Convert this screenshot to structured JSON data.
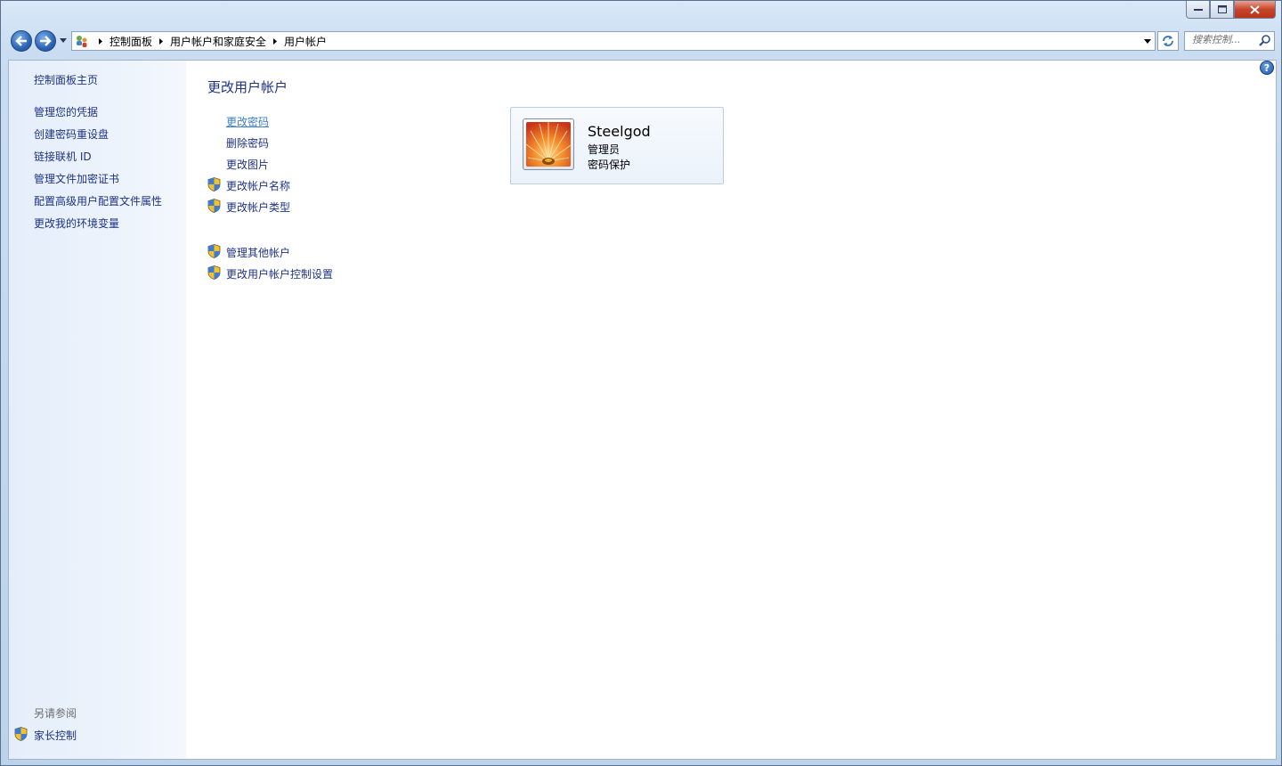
{
  "window": {
    "controls": {
      "minimize": "minimize-icon",
      "maximize": "maximize-icon",
      "close": "close-icon"
    }
  },
  "nav": {
    "back_icon": "back-arrow-icon",
    "forward_icon": "forward-arrow-icon",
    "breadcrumbs": [
      "控制面板",
      "用户帐户和家庭安全",
      "用户帐户"
    ],
    "search_placeholder": "搜索控制..."
  },
  "sidebar": {
    "home": "控制面板主页",
    "links": [
      "管理您的凭据",
      "创建密码重设盘",
      "链接联机 ID",
      "管理文件加密证书",
      "配置高级用户配置文件属性",
      "更改我的环境变量"
    ],
    "see_also_heading": "另请参阅",
    "see_also_links": [
      "家长控制"
    ]
  },
  "main": {
    "title": "更改用户帐户",
    "tasks": [
      "更改密码",
      "删除密码",
      "更改图片",
      "更改帐户名称",
      "更改帐户类型"
    ],
    "other_tasks": [
      "管理其他帐户",
      "更改用户帐户控制设置"
    ]
  },
  "account": {
    "name": "Steelgod",
    "role": "管理员",
    "protection": "密码保护"
  },
  "colors": {
    "link": "#1e3287",
    "hover_link": "#3c7fc8",
    "accent": "#2c64b6"
  }
}
